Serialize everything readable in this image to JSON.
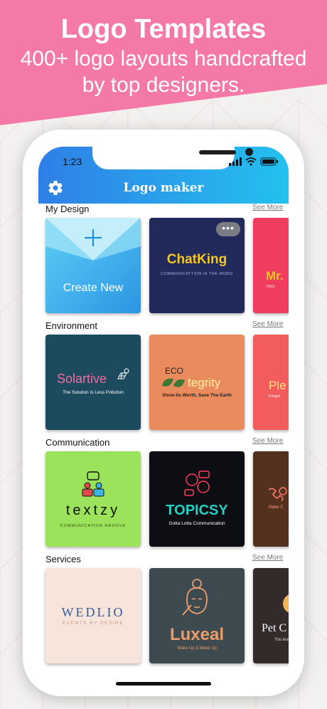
{
  "promo": {
    "title": "Logo Templates",
    "subtitle_line1": "400+ logo layouts handcrafted",
    "subtitle_line2": "by top designers."
  },
  "status_bar": {
    "time": "1:23"
  },
  "app": {
    "title": "Logo maker"
  },
  "see_more_label": "See More",
  "sections": [
    {
      "title": "My Design",
      "cards": [
        {
          "type": "create",
          "label": "Create New"
        },
        {
          "name": "ChatKing",
          "tagline": "COMMUNICATTION IS THE WORD",
          "menu": "•••"
        },
        {
          "partial": "Mr.",
          "tagline": "TAKE"
        }
      ]
    },
    {
      "title": "Environment",
      "cards": [
        {
          "name": "Solartive",
          "tagline": "The Solution Is Less Pollution"
        },
        {
          "name_top": "ECO",
          "name_rest": "tegrity",
          "tagline": "Show Its Worth, Save The Earth"
        },
        {
          "partial": "Ple",
          "tagline": "Forget"
        }
      ]
    },
    {
      "title": "Communication",
      "cards": [
        {
          "name": "textzy",
          "tagline": "COMMUNICATION GROOVE"
        },
        {
          "name": "TOPICSY",
          "tagline": "Gotta Lotta Communication"
        },
        {
          "tagline": "Make C"
        }
      ]
    },
    {
      "title": "Services",
      "cards": [
        {
          "name": "WEDLIO",
          "tagline": "EVENTS BY DESIRE"
        },
        {
          "name": "Luxeal",
          "tagline": "Wake Up & Make Up"
        },
        {
          "partial": "Pet C",
          "tagline": "You lea"
        }
      ]
    }
  ],
  "colors": {
    "promo_pink": "#f579a6",
    "header_gradient_start": "#2f7fe6",
    "header_gradient_end": "#24c1ef",
    "chatking_bg": "#222a5c",
    "mr_bg": "#ef3c5f",
    "solartive_bg": "#1c4b5e",
    "ecotegrity_bg": "#e98b5c",
    "ple_bg": "#f25c5c",
    "textzy_bg": "#9be35a",
    "topicsy_bg": "#0c0e14",
    "makec_bg": "#54301e",
    "wedlio_bg": "#f7e4da",
    "luxeal_bg": "#3d4b50",
    "petc_bg": "#332a2a"
  }
}
